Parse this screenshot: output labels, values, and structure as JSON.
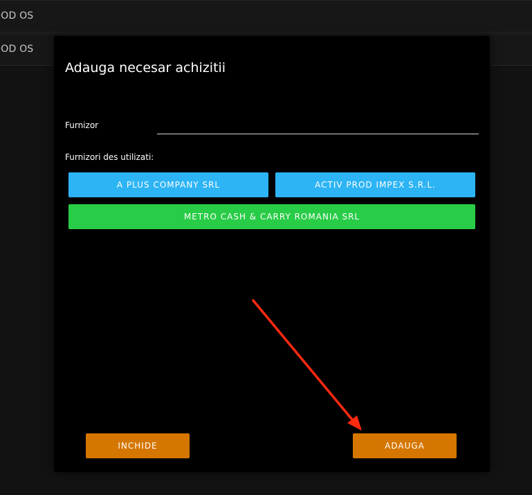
{
  "background": {
    "rows": [
      {
        "label": "OOD OS"
      },
      {
        "label": "OOD OS"
      }
    ]
  },
  "modal": {
    "title": "Adauga necesar achizitii",
    "field": {
      "label": "Furnizor",
      "value": "",
      "placeholder": ""
    },
    "suppliers_label": "Furnizori des utilizati:",
    "suppliers": [
      {
        "label": "A PLUS COMPANY SRL",
        "color": "#2db4f5"
      },
      {
        "label": "ACTIV PROD IMPEX S.R.L.",
        "color": "#2db4f5"
      },
      {
        "label": "METRO CASH & CARRY ROMANIA SRL",
        "color": "#28cc46"
      }
    ],
    "actions": {
      "close_label": "INCHIDE",
      "add_label": "ADAUGA",
      "color": "#d57600"
    }
  },
  "annotation": {
    "arrow_color": "#ff2a10"
  }
}
